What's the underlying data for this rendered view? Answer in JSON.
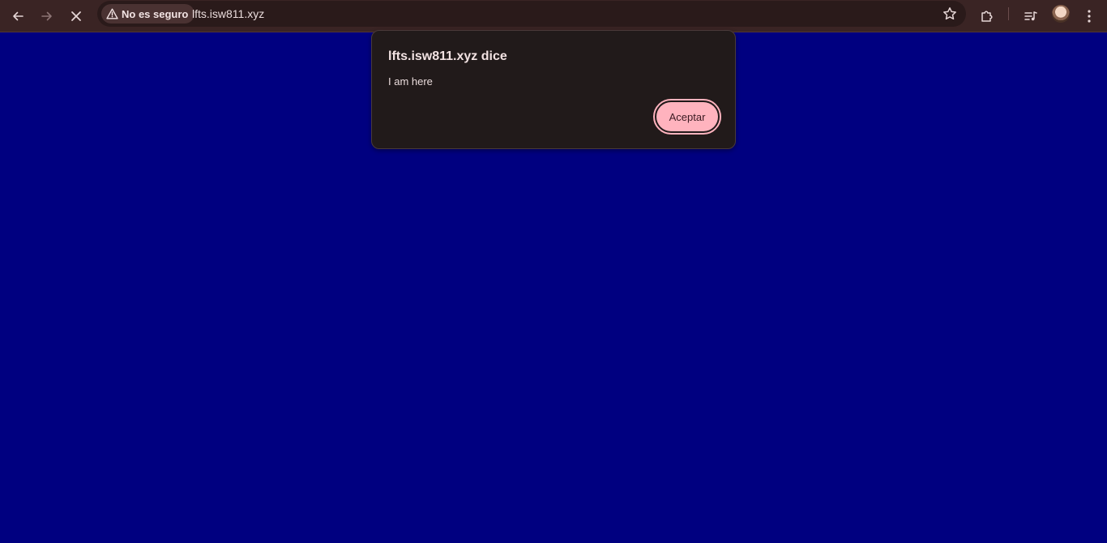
{
  "browser": {
    "security_label": "No es seguro",
    "url": "lfts.isw811.xyz",
    "icons": [
      "back-arrow-icon",
      "forward-arrow-icon",
      "stop-loading-icon",
      "warning-icon",
      "bookmark-star-icon",
      "extensions-puzzle-icon",
      "media-controls-icon",
      "profile-avatar",
      "menu-dots-icon"
    ]
  },
  "dialog": {
    "title": "lfts.isw811.xyz dice",
    "message": "I am here",
    "ok_label": "Aceptar"
  },
  "colors": {
    "page_background": "#000080",
    "toolbar_background": "#3a2424",
    "dialog_background": "#211a1a",
    "accent": "#ffb3be"
  }
}
